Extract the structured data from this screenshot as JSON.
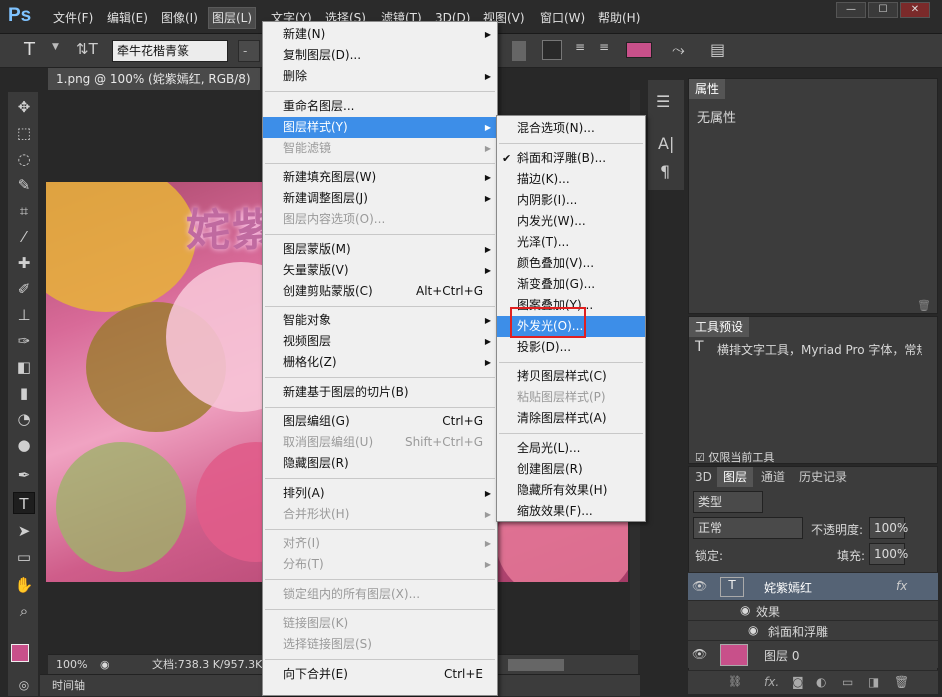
{
  "menubar": {
    "logo": "Ps",
    "items": [
      "文件(F)",
      "编辑(E)",
      "图像(I)",
      "图层(L)",
      "文字(Y)",
      "选择(S)",
      "滤镜(T)",
      "3D(D)",
      "视图(V)",
      "窗口(W)",
      "帮助(H)"
    ],
    "win_controls": [
      "—",
      "☐",
      "✕"
    ]
  },
  "options": {
    "tool_icon": "T",
    "font_family": "牵牛花楷青篆",
    "size_placeholder": "-",
    "color": "#c8508a"
  },
  "document": {
    "tab_title": "1.png @ 100% (姹紫嫣红, RGB/8) *",
    "close": "×",
    "canvas_text": "姹紫",
    "zoom": "100%",
    "doc_info": "文档:738.3 K/957.3K"
  },
  "timeline": {
    "label": "时间轴"
  },
  "layer_menu": {
    "items": [
      {
        "label": "新建(N)",
        "arrow": true
      },
      {
        "label": "复制图层(D)..."
      },
      {
        "label": "删除",
        "arrow": true
      },
      {
        "sep": true
      },
      {
        "label": "重命名图层..."
      },
      {
        "label": "图层样式(Y)",
        "arrow": true,
        "hl": true
      },
      {
        "label": "智能滤镜",
        "arrow": true,
        "dis": true
      },
      {
        "sep": true
      },
      {
        "label": "新建填充图层(W)",
        "arrow": true
      },
      {
        "label": "新建调整图层(J)",
        "arrow": true
      },
      {
        "label": "图层内容选项(O)...",
        "dis": true
      },
      {
        "sep": true
      },
      {
        "label": "图层蒙版(M)",
        "arrow": true
      },
      {
        "label": "矢量蒙版(V)",
        "arrow": true
      },
      {
        "label": "创建剪贴蒙版(C)",
        "sc": "Alt+Ctrl+G"
      },
      {
        "sep": true
      },
      {
        "label": "智能对象",
        "arrow": true
      },
      {
        "label": "视频图层",
        "arrow": true
      },
      {
        "label": "栅格化(Z)",
        "arrow": true
      },
      {
        "sep": true
      },
      {
        "label": "新建基于图层的切片(B)"
      },
      {
        "sep": true
      },
      {
        "label": "图层编组(G)",
        "sc": "Ctrl+G"
      },
      {
        "label": "取消图层编组(U)",
        "sc": "Shift+Ctrl+G",
        "dis": true
      },
      {
        "label": "隐藏图层(R)"
      },
      {
        "sep": true
      },
      {
        "label": "排列(A)",
        "arrow": true
      },
      {
        "label": "合并形状(H)",
        "arrow": true,
        "dis": true
      },
      {
        "sep": true
      },
      {
        "label": "对齐(I)",
        "arrow": true,
        "dis": true
      },
      {
        "label": "分布(T)",
        "arrow": true,
        "dis": true
      },
      {
        "sep": true
      },
      {
        "label": "锁定组内的所有图层(X)...",
        "dis": true
      },
      {
        "sep": true
      },
      {
        "label": "链接图层(K)",
        "dis": true
      },
      {
        "label": "选择链接图层(S)",
        "dis": true
      },
      {
        "sep": true
      },
      {
        "label": "向下合并(E)",
        "sc": "Ctrl+E"
      }
    ]
  },
  "style_menu": {
    "items": [
      {
        "label": "混合选项(N)..."
      },
      {
        "sep": true
      },
      {
        "label": "斜面和浮雕(B)...",
        "check": true
      },
      {
        "label": "描边(K)..."
      },
      {
        "label": "内阴影(I)..."
      },
      {
        "label": "内发光(W)..."
      },
      {
        "label": "光泽(T)..."
      },
      {
        "label": "颜色叠加(V)..."
      },
      {
        "label": "渐变叠加(G)..."
      },
      {
        "label": "图案叠加(Y)..."
      },
      {
        "label": "外发光(O)...",
        "hl": true
      },
      {
        "label": "投影(D)..."
      },
      {
        "sep": true
      },
      {
        "label": "拷贝图层样式(C)"
      },
      {
        "label": "粘贴图层样式(P)",
        "dis": true
      },
      {
        "label": "清除图层样式(A)"
      },
      {
        "sep": true
      },
      {
        "label": "全局光(L)..."
      },
      {
        "label": "创建图层(R)"
      },
      {
        "label": "隐藏所有效果(H)"
      },
      {
        "label": "缩放效果(F)..."
      }
    ]
  },
  "properties": {
    "tab": "属性",
    "body": "无属性"
  },
  "tool_presets": {
    "tab": "工具预设",
    "row": "横排文字工具，Myriad Pro 字体，常规",
    "footer": "仅限当前工具"
  },
  "layers": {
    "tabs": [
      "3D",
      "图层",
      "通道",
      "历史记录"
    ],
    "filter": "类型",
    "blend": "正常",
    "opacity_label": "不透明度:",
    "opacity": "100%",
    "lock_label": "锁定:",
    "fill_label": "填充:",
    "fill": "100%",
    "rows": [
      {
        "name": "姹紫嫣红",
        "fx": "fx"
      },
      {
        "name": "效果"
      },
      {
        "name": "斜面和浮雕"
      },
      {
        "name": "图层 0"
      }
    ]
  }
}
